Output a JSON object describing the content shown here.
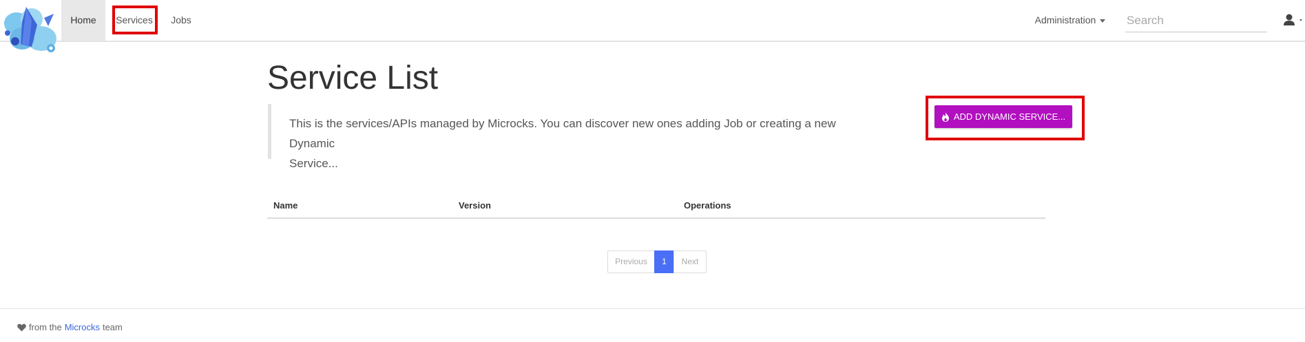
{
  "nav": {
    "home": "Home",
    "services": "Services",
    "jobs": "Jobs",
    "administration": "Administration",
    "search_placeholder": "Search"
  },
  "page": {
    "title": "Service List",
    "description_line1": "This is the services/APIs managed by Microcks. You can discover new ones adding Job or creating a new Dynamic",
    "description_line2": "Service...",
    "add_button": "ADD DYNAMIC SERVICE..."
  },
  "table": {
    "columns": [
      "Name",
      "Version",
      "Operations"
    ]
  },
  "pagination": {
    "previous": "Previous",
    "current": "1",
    "next": "Next"
  },
  "footer": {
    "prefix": "from the",
    "link": "Microcks",
    "suffix": "team"
  },
  "colors": {
    "accent_button": "#b10fbf",
    "pagination_active": "#4a6ef5",
    "highlight_box": "#e00000"
  },
  "icons": [
    "logo-icon",
    "caret-down-icon",
    "user-icon",
    "fire-icon",
    "heart-icon"
  ]
}
